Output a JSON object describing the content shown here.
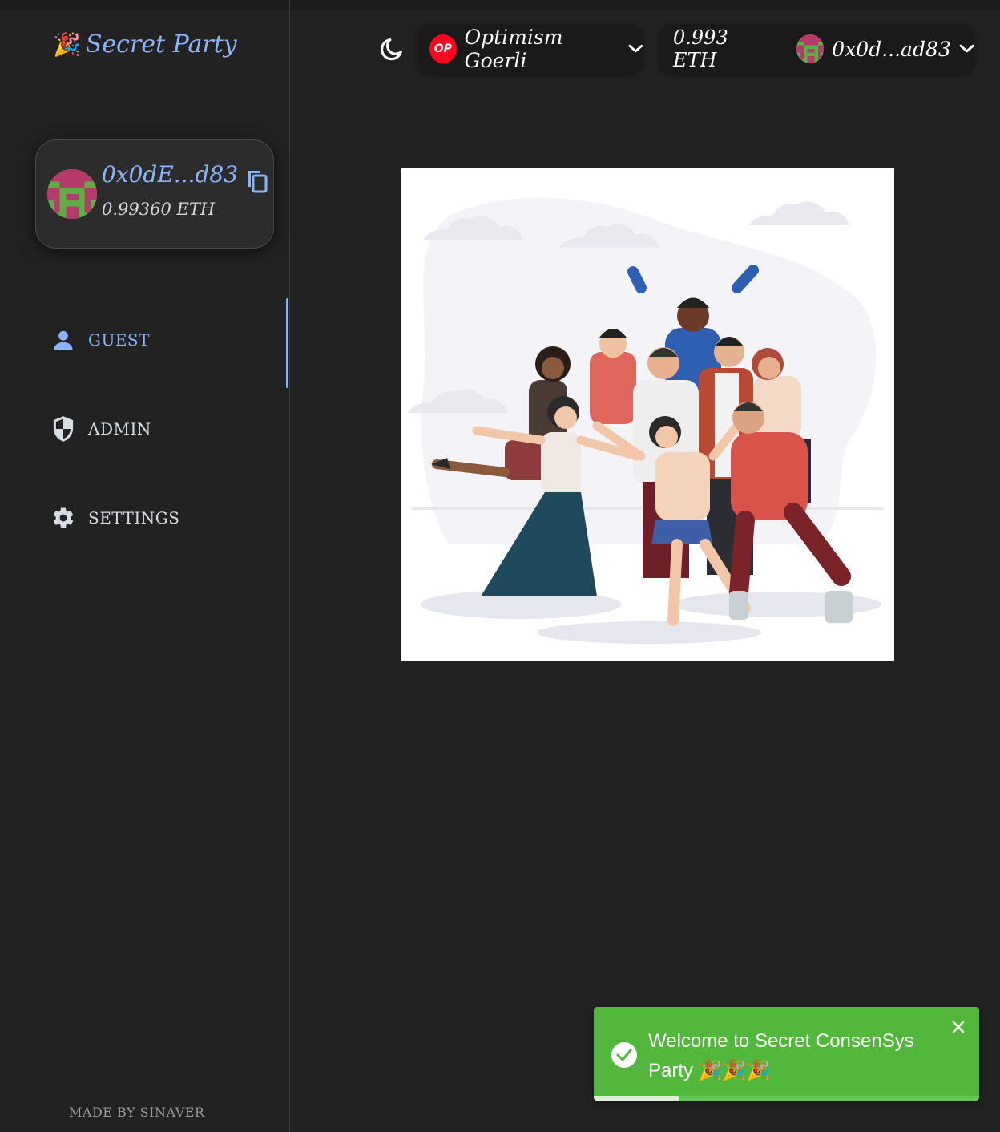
{
  "app": {
    "logo_emoji": "🎉",
    "title": "Secret Party"
  },
  "account_card": {
    "address": "0x0dE...d83",
    "balance": "0.99360 ETH",
    "icons": {
      "avatar": "avatar-identicon",
      "copy": "copy-icon"
    }
  },
  "sidebar": {
    "items": [
      {
        "label": "GUEST",
        "icon": "person-icon",
        "active": true
      },
      {
        "label": "ADMIN",
        "icon": "shield-icon",
        "active": false
      },
      {
        "label": "SETTINGS",
        "icon": "gear-icon",
        "active": false
      }
    ],
    "accent": "#8ab4f8"
  },
  "footer": {
    "text": "MADE BY SINAVER"
  },
  "topbar": {
    "theme_toggle_icon": "moon-icon",
    "network": {
      "badge": "OP",
      "name": "Optimism Goerli",
      "badge_color": "#ff0420"
    },
    "wallet": {
      "balance": "0.993 ETH",
      "address": "0x0d...ad83"
    }
  },
  "hero": {
    "illustration": "group-of-people-celebrating"
  },
  "toast": {
    "message": "Welcome to Secret ConsenSys Party 🎉🎉🎉",
    "type": "success",
    "color": "#52b83c",
    "progress": 0.22
  }
}
